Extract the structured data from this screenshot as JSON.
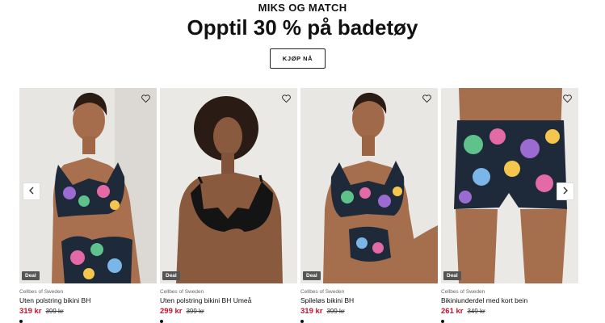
{
  "hero": {
    "eyebrow": "MIKS OG MATCH",
    "headline": "Opptil 30 % på badetøy",
    "cta_label": "KJØP NÅ"
  },
  "products": [
    {
      "badge": "Deal",
      "brand": "Cellbes of Sweden",
      "name": "Uten polstring bikini BH",
      "price": "319 kr",
      "old_price": "399 kr",
      "icon": "heart-icon"
    },
    {
      "badge": "Deal",
      "brand": "Cellbes of Sweden",
      "name": "Uten polstring bikini BH Umeå",
      "price": "299 kr",
      "old_price": "399 kr",
      "icon": "heart-icon"
    },
    {
      "badge": "Deal",
      "brand": "Cellbes of Sweden",
      "name": "Spileløs bikini BH",
      "price": "319 kr",
      "old_price": "399 kr",
      "icon": "heart-icon"
    },
    {
      "badge": "Deal",
      "brand": "Cellbes of Sweden",
      "name": "Bikiniunderdel med kort bein",
      "price": "261 kr",
      "old_price": "349 kr",
      "icon": "heart-icon"
    }
  ],
  "carousel": {
    "prev_icon": "chevron-left-icon",
    "next_icon": "chevron-right-icon"
  },
  "colors": {
    "sale_price": "#c8102e",
    "badge_bg": "#555555",
    "cta_border": "#222222"
  }
}
